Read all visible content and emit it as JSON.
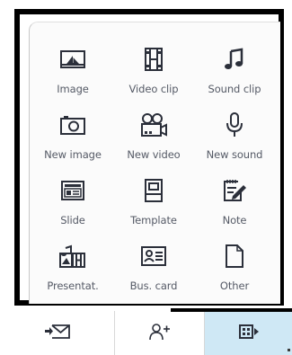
{
  "popup": {
    "items": [
      {
        "label": "Image",
        "icon": "image-icon"
      },
      {
        "label": "Video clip",
        "icon": "video-clip-icon"
      },
      {
        "label": "Sound clip",
        "icon": "sound-clip-icon"
      },
      {
        "label": "New image",
        "icon": "camera-icon"
      },
      {
        "label": "New video",
        "icon": "video-camera-icon"
      },
      {
        "label": "New sound",
        "icon": "microphone-icon"
      },
      {
        "label": "Slide",
        "icon": "slide-icon"
      },
      {
        "label": "Template",
        "icon": "template-icon"
      },
      {
        "label": "Note",
        "icon": "note-icon"
      },
      {
        "label": "Presentat.",
        "icon": "presentation-icon"
      },
      {
        "label": "Bus. card",
        "icon": "business-card-icon"
      },
      {
        "label": "Other",
        "icon": "document-icon"
      }
    ]
  },
  "toolbar": {
    "buttons": [
      {
        "icon": "send-message-icon"
      },
      {
        "icon": "add-recipient-icon"
      },
      {
        "icon": "insert-icon",
        "selected": true
      }
    ]
  },
  "colors": {
    "icon": "#2b2f3a",
    "label": "#555a66",
    "selected_bg": "#cfe8f5"
  }
}
